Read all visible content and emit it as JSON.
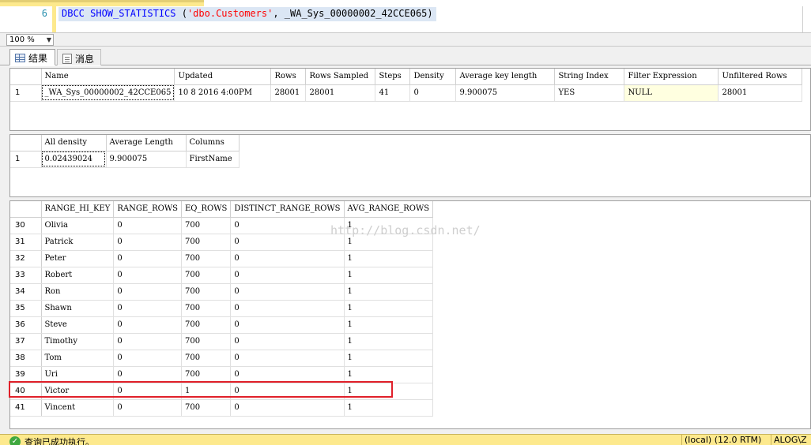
{
  "editor": {
    "line_number": "6",
    "sql_keyword": "DBCC SHOW_STATISTICS",
    "sql_open": " (",
    "sql_string": "'dbo.Customers'",
    "sql_rest": ", _WA_Sys_00000002_42CCE065)"
  },
  "zoom": {
    "value": "100 %"
  },
  "tabs": [
    {
      "label": "结果"
    },
    {
      "label": "消息"
    }
  ],
  "header_table": {
    "columns": [
      "Name",
      "Updated",
      "Rows",
      "Rows Sampled",
      "Steps",
      "Density",
      "Average key length",
      "String Index",
      "Filter Expression",
      "Unfiltered Rows"
    ],
    "rows": [
      {
        "rn": "1",
        "cells": [
          "_WA_Sys_00000002_42CCE065",
          "10  8 2016  4:00PM",
          "28001",
          "28001",
          "41",
          "0",
          "9.900075",
          "YES",
          "NULL",
          "28001"
        ]
      }
    ]
  },
  "density_table": {
    "columns": [
      "All density",
      "Average Length",
      "Columns"
    ],
    "rows": [
      {
        "rn": "1",
        "cells": [
          "0.02439024",
          "9.900075",
          "FirstName"
        ]
      }
    ]
  },
  "histogram_table": {
    "columns": [
      "RANGE_HI_KEY",
      "RANGE_ROWS",
      "EQ_ROWS",
      "DISTINCT_RANGE_ROWS",
      "AVG_RANGE_ROWS"
    ],
    "rows": [
      {
        "rn": "30",
        "cells": [
          "Olivia",
          "0",
          "700",
          "0",
          "1"
        ]
      },
      {
        "rn": "31",
        "cells": [
          "Patrick",
          "0",
          "700",
          "0",
          "1"
        ]
      },
      {
        "rn": "32",
        "cells": [
          "Peter",
          "0",
          "700",
          "0",
          "1"
        ]
      },
      {
        "rn": "33",
        "cells": [
          "Robert",
          "0",
          "700",
          "0",
          "1"
        ]
      },
      {
        "rn": "34",
        "cells": [
          "Ron",
          "0",
          "700",
          "0",
          "1"
        ]
      },
      {
        "rn": "35",
        "cells": [
          "Shawn",
          "0",
          "700",
          "0",
          "1"
        ]
      },
      {
        "rn": "36",
        "cells": [
          "Steve",
          "0",
          "700",
          "0",
          "1"
        ]
      },
      {
        "rn": "37",
        "cells": [
          "Timothy",
          "0",
          "700",
          "0",
          "1"
        ]
      },
      {
        "rn": "38",
        "cells": [
          "Tom",
          "0",
          "700",
          "0",
          "1"
        ]
      },
      {
        "rn": "39",
        "cells": [
          "Uri",
          "0",
          "700",
          "0",
          "1"
        ]
      },
      {
        "rn": "40",
        "cells": [
          "Victor",
          "0",
          "1",
          "0",
          "1"
        ]
      },
      {
        "rn": "41",
        "cells": [
          "Vincent",
          "0",
          "700",
          "0",
          "1"
        ]
      }
    ]
  },
  "watermark": "http://blog.csdn.net/",
  "status": {
    "message": "查询已成功执行。",
    "server": "(local) (12.0 RTM)",
    "user": "ALOG\\Z"
  }
}
